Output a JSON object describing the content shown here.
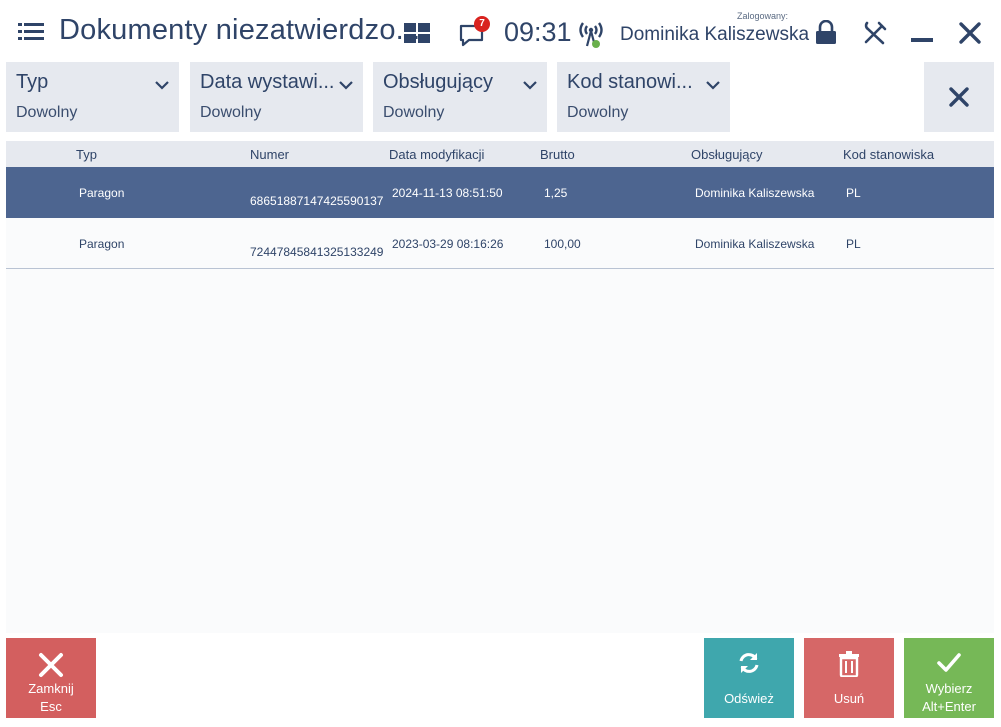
{
  "header": {
    "title": "Dokumenty niezatwierdzo...",
    "notification_count": "7",
    "time": "09:31",
    "logged_label": "Zalogowany:",
    "user_name": "Dominika Kaliszewska"
  },
  "filters": [
    {
      "label": "Typ",
      "value": "Dowolny"
    },
    {
      "label": "Data wystawi...",
      "value": "Dowolny"
    },
    {
      "label": "Obsługujący",
      "value": "Dowolny"
    },
    {
      "label": "Kod stanowi...",
      "value": "Dowolny"
    }
  ],
  "table": {
    "columns": [
      "Typ",
      "Numer",
      "Data modyfikacji",
      "Brutto",
      "Obsługujący",
      "Kod stanowiska"
    ],
    "rows": [
      {
        "typ": "Paragon",
        "numer": "68651887147425590137",
        "data": "2024-11-13 08:51:50",
        "brutto": "1,25",
        "obslugujacy": "Dominika Kaliszewska",
        "kod": "PL",
        "selected": true
      },
      {
        "typ": "Paragon",
        "numer": "72447845841325133249",
        "data": "2023-03-29 08:16:26",
        "brutto": "100,00",
        "obslugujacy": "Dominika Kaliszewska",
        "kod": "PL",
        "selected": false
      }
    ]
  },
  "buttons": {
    "close_label": "Zamknij",
    "close_shortcut": "Esc",
    "refresh_label": "Odśwież",
    "delete_label": "Usuń",
    "select_label": "Wybierz",
    "select_shortcut": "Alt+Enter"
  },
  "icons": {
    "menu": "hamburger-menu-icon",
    "tiles": "tiles-icon",
    "notifications": "chat-bubble-icon",
    "signal": "antenna-icon",
    "lock": "lock-icon",
    "tools": "tools-icon",
    "minimize": "minimize-icon",
    "close": "close-icon"
  },
  "colors": {
    "primary": "#2f4468",
    "selected_row": "#4d6590",
    "filter_bg": "#e6e9ef",
    "close_btn": "#d35f5f",
    "refresh_btn": "#3fa7ad",
    "delete_btn": "#d66767",
    "select_btn": "#76b857",
    "badge": "#d9231f",
    "online": "#6ab04c"
  }
}
